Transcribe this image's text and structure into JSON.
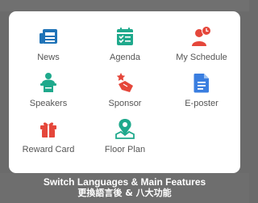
{
  "menu": {
    "items": [
      {
        "label": "News",
        "icon": "newspaper-icon",
        "color": "#1f73b7"
      },
      {
        "label": "Agenda",
        "icon": "calendar-checklist-icon",
        "color": "#1fa98c"
      },
      {
        "label": "My Schedule",
        "icon": "person-clock-icon",
        "color": "#e5473b"
      },
      {
        "label": "Speakers",
        "icon": "speaker-podium-icon",
        "color": "#1fa98c"
      },
      {
        "label": "Sponsor",
        "icon": "handshake-star-icon",
        "color": "#e5473b"
      },
      {
        "label": "E-poster",
        "icon": "document-icon",
        "color": "#3a7ee0"
      },
      {
        "label": "Reward Card",
        "icon": "gift-icon",
        "color": "#e5473b"
      },
      {
        "label": "Floor Plan",
        "icon": "map-pin-icon",
        "color": "#1fa98c"
      }
    ]
  },
  "caption": {
    "line1": "Switch Languages & Main Features",
    "line2": "更換語言後 & 八大功能"
  }
}
